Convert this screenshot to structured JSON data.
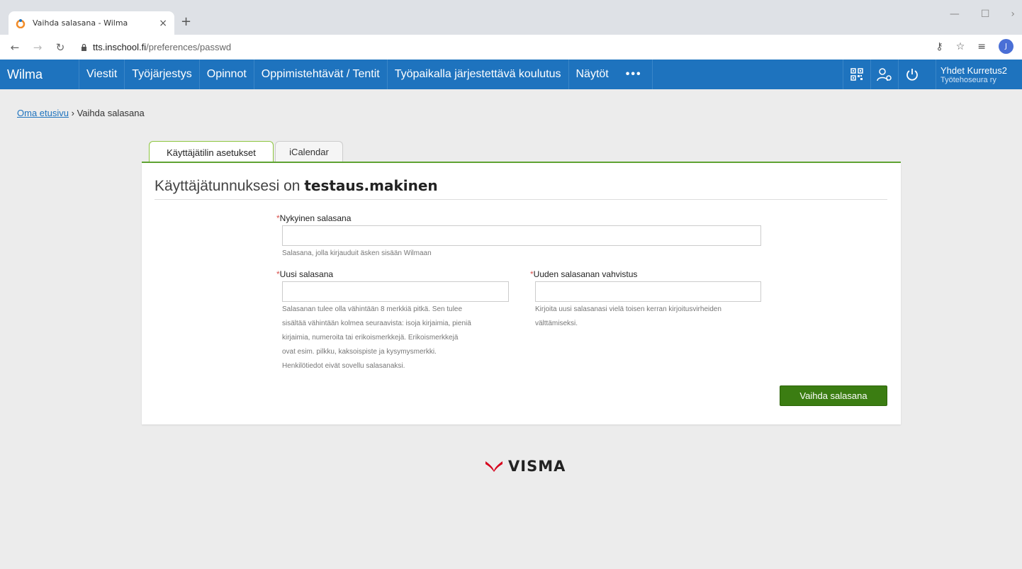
{
  "browser": {
    "tab_title": "Vaihda salasana - Wilma",
    "tab_close": "×",
    "new_tab": "+",
    "url_host": "tts.inschool.fi",
    "url_path": "/preferences/passwd",
    "profile_initial": "J"
  },
  "nav": {
    "brand": "Wilma",
    "items": [
      "Viestit",
      "Työjärjestys",
      "Opinnot",
      "Oppimistehtävät / Tentit",
      "Työpaikalla järjestettävä koulutus",
      "Näytöt"
    ],
    "more": "•••",
    "user_name": "Yhdet Kurretus2",
    "user_org": "Työtehoseura ry",
    "color": "#1e73be"
  },
  "breadcrumb": {
    "home": "Oma etusivu",
    "separator": "›",
    "current": "Vaihda salasana"
  },
  "tabs": {
    "active": "Käyttäjätilin asetukset",
    "inactive": "iCalendar"
  },
  "form": {
    "title_prefix": "Käyttäjätunnuksesi on",
    "username": "testaus.makinen",
    "required_mark": "*",
    "current_label": "Nykyinen salasana",
    "current_value": "",
    "current_hint": "Salasana, jolla kirjauduit äsken sisään Wilmaan",
    "new_label": "Uusi salasana",
    "new_value": "",
    "new_hint_lines": [
      "Salasanan tulee olla vähintään 8 merkkiä pitkä. Sen tulee",
      "sisältää vähintään kolmea seuraavista: isoja kirjaimia, pieniä",
      "kirjaimia, numeroita tai erikoismerkkejä. Erikoismerkkejä",
      "ovat esim. pilkku, kaksoispiste ja kysymysmerkki.",
      "Henkilötiedot eivät sovellu salasanaksi."
    ],
    "confirm_label": "Uuden salasanan vahvistus",
    "confirm_value": "",
    "confirm_hint_lines": [
      "Kirjoita uusi salasanasi vielä toisen kerran kirjoitusvirheiden",
      "välttämiseksi."
    ],
    "submit": "Vaihda salasana"
  },
  "footer": {
    "logo_text": "VISMA"
  }
}
